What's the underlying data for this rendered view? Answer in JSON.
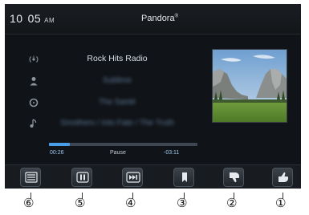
{
  "status_bar": {
    "hour": "10",
    "minute": "05",
    "ampm": "AM",
    "source": "Pandora",
    "source_mark": "®"
  },
  "track": {
    "station": "Rock Hits Radio",
    "artist": "Sublime",
    "album": "The Santé",
    "title": "Smothers / Into Fate / The Truth",
    "artist_icon": "person-icon",
    "album_icon": "disc-icon",
    "title_icon": "music-note-icon",
    "station_icon": "radio-signal-icon"
  },
  "playback": {
    "elapsed": "00:26",
    "status": "Pause",
    "remaining": "-03:11",
    "progress": 0.14
  },
  "controls": [
    {
      "name": "menu",
      "icon": "list-icon"
    },
    {
      "name": "pause",
      "icon": "pause-icon"
    },
    {
      "name": "skip",
      "icon": "skip-forward-icon"
    },
    {
      "name": "bookmark",
      "icon": "bookmark-icon"
    },
    {
      "name": "thumbs-down",
      "icon": "thumbs-down-icon"
    },
    {
      "name": "thumbs-up",
      "icon": "thumbs-up-icon"
    }
  ],
  "callouts": [
    "⑥",
    "⑤",
    "④",
    "③",
    "②",
    "①"
  ],
  "colors": {
    "accent": "#4a9ee8",
    "background": "#101317",
    "text": "#d6dee6"
  }
}
